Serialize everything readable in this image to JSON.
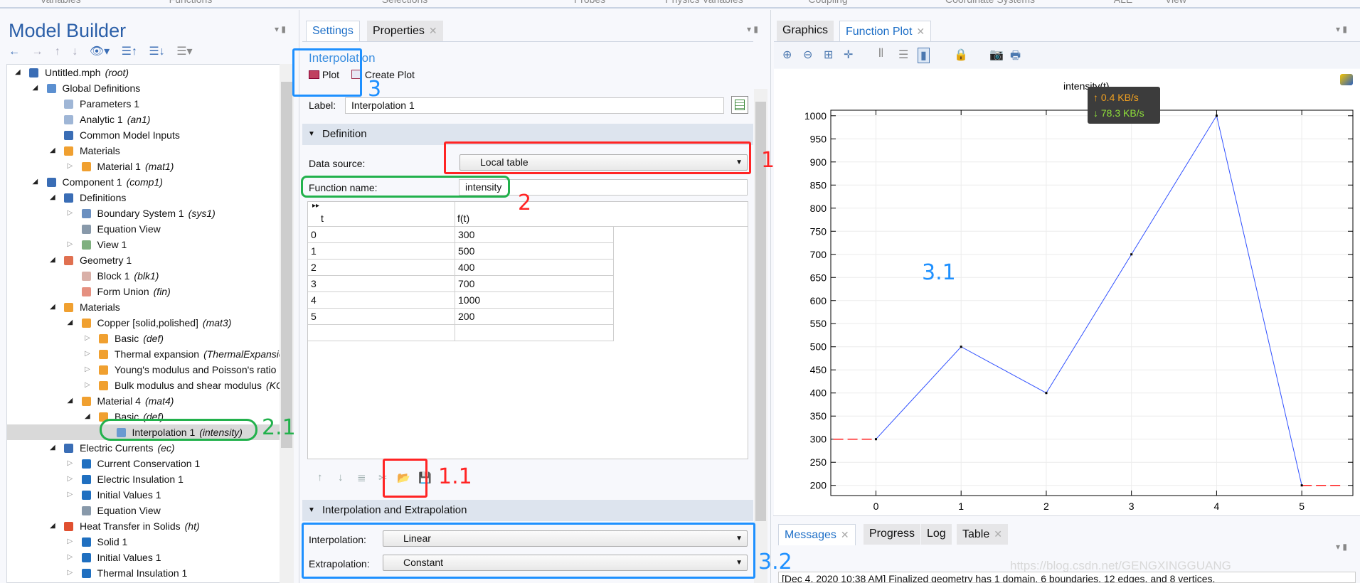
{
  "ribbon": [
    "Variables",
    "Functions",
    "Selections",
    "Probes",
    "Physics Variables",
    "Coupling",
    "Coordinate Systems",
    "ALE",
    "View"
  ],
  "model_builder": {
    "title": "Model Builder",
    "tree": [
      {
        "label": "Untitled.mph",
        "tag": "(root)",
        "level": 0,
        "state": "open",
        "icon": "root-icon",
        "color": "#3a6db5"
      },
      {
        "label": "Global Definitions",
        "tag": "",
        "level": 1,
        "state": "open",
        "icon": "globe-icon",
        "color": "#5b8fd0"
      },
      {
        "label": "Parameters 1",
        "tag": "",
        "level": 2,
        "state": "none",
        "icon": "parameters-icon",
        "color": "#9fb6d6"
      },
      {
        "label": "Analytic 1",
        "tag": "(an1)",
        "level": 2,
        "state": "none",
        "icon": "function-icon",
        "color": "#9fb6d6"
      },
      {
        "label": "Common Model Inputs",
        "tag": "",
        "level": 2,
        "state": "none",
        "icon": "model-inputs-icon",
        "color": "#3a6db5"
      },
      {
        "label": "Materials",
        "tag": "",
        "level": 2,
        "state": "open",
        "icon": "materials-icon",
        "color": "#f0a030"
      },
      {
        "label": "Material 1",
        "tag": "(mat1)",
        "level": 3,
        "state": "closed",
        "icon": "material-icon",
        "color": "#f0a030"
      },
      {
        "label": "Component 1",
        "tag": "(comp1)",
        "level": 1,
        "state": "open",
        "icon": "component-icon",
        "color": "#3a6db5"
      },
      {
        "label": "Definitions",
        "tag": "",
        "level": 2,
        "state": "open",
        "icon": "definitions-icon",
        "color": "#3a6db5"
      },
      {
        "label": "Boundary System 1",
        "tag": "(sys1)",
        "level": 3,
        "state": "closed",
        "icon": "coordinate-system-icon",
        "color": "#6a8fc0"
      },
      {
        "label": "Equation View",
        "tag": "",
        "level": 3,
        "state": "none",
        "icon": "equation-icon",
        "color": "#8899aa"
      },
      {
        "label": "View 1",
        "tag": "",
        "level": 3,
        "state": "closed",
        "icon": "view-icon",
        "color": "#7fb07f"
      },
      {
        "label": "Geometry 1",
        "tag": "",
        "level": 2,
        "state": "open",
        "icon": "geometry-icon",
        "color": "#e07050"
      },
      {
        "label": "Block 1",
        "tag": "(blk1)",
        "level": 3,
        "state": "none",
        "icon": "block-icon",
        "color": "#d9b0a8"
      },
      {
        "label": "Form Union",
        "tag": "(fin)",
        "level": 3,
        "state": "none",
        "icon": "form-union-icon",
        "color": "#e59080"
      },
      {
        "label": "Materials",
        "tag": "",
        "level": 2,
        "state": "open",
        "icon": "materials-icon",
        "color": "#f0a030"
      },
      {
        "label": "Copper [solid,polished]",
        "tag": "(mat3)",
        "level": 3,
        "state": "open",
        "icon": "material-icon",
        "color": "#f0a030"
      },
      {
        "label": "Basic",
        "tag": "(def)",
        "level": 4,
        "state": "closed",
        "icon": "material-icon",
        "color": "#f0a030"
      },
      {
        "label": "Thermal expansion",
        "tag": "(ThermalExpansion)",
        "level": 4,
        "state": "closed",
        "icon": "material-icon",
        "color": "#f0a030"
      },
      {
        "label": "Young's modulus and Poisson's ratio",
        "tag": "",
        "level": 4,
        "state": "closed",
        "icon": "material-icon",
        "color": "#f0a030"
      },
      {
        "label": "Bulk modulus and shear modulus",
        "tag": "(KG)",
        "level": 4,
        "state": "closed",
        "icon": "material-icon",
        "color": "#f0a030"
      },
      {
        "label": "Material 4",
        "tag": "(mat4)",
        "level": 3,
        "state": "open",
        "icon": "material-icon",
        "color": "#f0a030"
      },
      {
        "label": "Basic",
        "tag": "(def)",
        "level": 4,
        "state": "open",
        "icon": "material-icon",
        "color": "#f0a030"
      },
      {
        "label": "Interpolation 1",
        "tag": "(intensity)",
        "level": 5,
        "state": "none",
        "icon": "interpolation-icon",
        "color": "#6a9ad0",
        "selected": true
      },
      {
        "label": "Electric Currents",
        "tag": "(ec)",
        "level": 2,
        "state": "open",
        "icon": "electric-currents-icon",
        "color": "#3a6db5"
      },
      {
        "label": "Current Conservation 1",
        "tag": "",
        "level": 3,
        "state": "closed",
        "icon": "domain-icon",
        "color": "#1f6fc0"
      },
      {
        "label": "Electric Insulation 1",
        "tag": "",
        "level": 3,
        "state": "closed",
        "icon": "boundary-icon",
        "color": "#1f6fc0"
      },
      {
        "label": "Initial Values 1",
        "tag": "",
        "level": 3,
        "state": "closed",
        "icon": "domain-icon",
        "color": "#1f6fc0"
      },
      {
        "label": "Equation View",
        "tag": "",
        "level": 3,
        "state": "none",
        "icon": "equation-icon",
        "color": "#8899aa"
      },
      {
        "label": "Heat Transfer in Solids",
        "tag": "(ht)",
        "level": 2,
        "state": "open",
        "icon": "heat-transfer-icon",
        "color": "#e05030"
      },
      {
        "label": "Solid 1",
        "tag": "",
        "level": 3,
        "state": "closed",
        "icon": "domain-icon",
        "color": "#1f6fc0"
      },
      {
        "label": "Initial Values 1",
        "tag": "",
        "level": 3,
        "state": "closed",
        "icon": "domain-icon",
        "color": "#1f6fc0"
      },
      {
        "label": "Thermal Insulation 1",
        "tag": "",
        "level": 3,
        "state": "closed",
        "icon": "boundary-icon",
        "color": "#1f6fc0"
      }
    ]
  },
  "settings": {
    "tabs": [
      "Settings",
      "Properties"
    ],
    "node_title": "Interpolation",
    "plot": "Plot",
    "create_plot": "Create Plot",
    "label_label": "Label:",
    "label_value": "Interpolation 1",
    "definition": "Definition",
    "data_source_label": "Data source:",
    "data_source": "Local table",
    "function_name_label": "Function name:",
    "function_name": "intensity",
    "table": {
      "columns": [
        "t",
        "f(t)"
      ],
      "rows": [
        [
          "0",
          "300"
        ],
        [
          "1",
          "500"
        ],
        [
          "2",
          "400"
        ],
        [
          "3",
          "700"
        ],
        [
          "4",
          "1000"
        ],
        [
          "5",
          "200"
        ],
        [
          "",
          ""
        ]
      ]
    },
    "interp_section": "Interpolation and Extrapolation",
    "interpolation_label": "Interpolation:",
    "interpolation": "Linear",
    "extrapolation_label": "Extrapolation:",
    "extrapolation": "Constant"
  },
  "graphics": {
    "tabs": [
      "Graphics",
      "Function Plot"
    ]
  },
  "net_overlay": {
    "up": "↑ 0.4 KB/s",
    "down": "↓ 78.3 KB/s"
  },
  "chart_data": {
    "type": "line",
    "title": "intensity(t)",
    "x": [
      0,
      1,
      2,
      3,
      4,
      5
    ],
    "y": [
      300,
      500,
      400,
      700,
      1000,
      200
    ],
    "xlim": [
      -0.53,
      5.6
    ],
    "ylim": [
      178,
      1012
    ],
    "xticks": [
      0,
      1,
      2,
      3,
      4,
      5
    ],
    "yticks": [
      200,
      250,
      300,
      350,
      400,
      450,
      500,
      550,
      600,
      650,
      700,
      750,
      800,
      850,
      900,
      950,
      1000
    ],
    "grid": true,
    "line_color": "#3050ff",
    "extrapolation": [
      {
        "x": [
          -0.5,
          0
        ],
        "y": [
          300,
          300
        ]
      },
      {
        "x": [
          5,
          5.5
        ],
        "y": [
          200,
          200
        ]
      }
    ],
    "extrapolation_color": "#ff2020"
  },
  "messages": {
    "tabs": [
      "Messages",
      "Progress",
      "Log",
      "Table"
    ],
    "text": "[Dec 4, 2020 10:38 AM] Finalized geometry has 1 domain, 6 boundaries, 12 edges, and 8 vertices."
  },
  "watermark": "https://blog.csdn.net/GENGXINGGUANG",
  "annotations": {
    "a1": "1",
    "a11": "1.1",
    "a2": "2",
    "a21": "2.1",
    "a3": "3",
    "a31": "3.1",
    "a32": "3.2"
  }
}
